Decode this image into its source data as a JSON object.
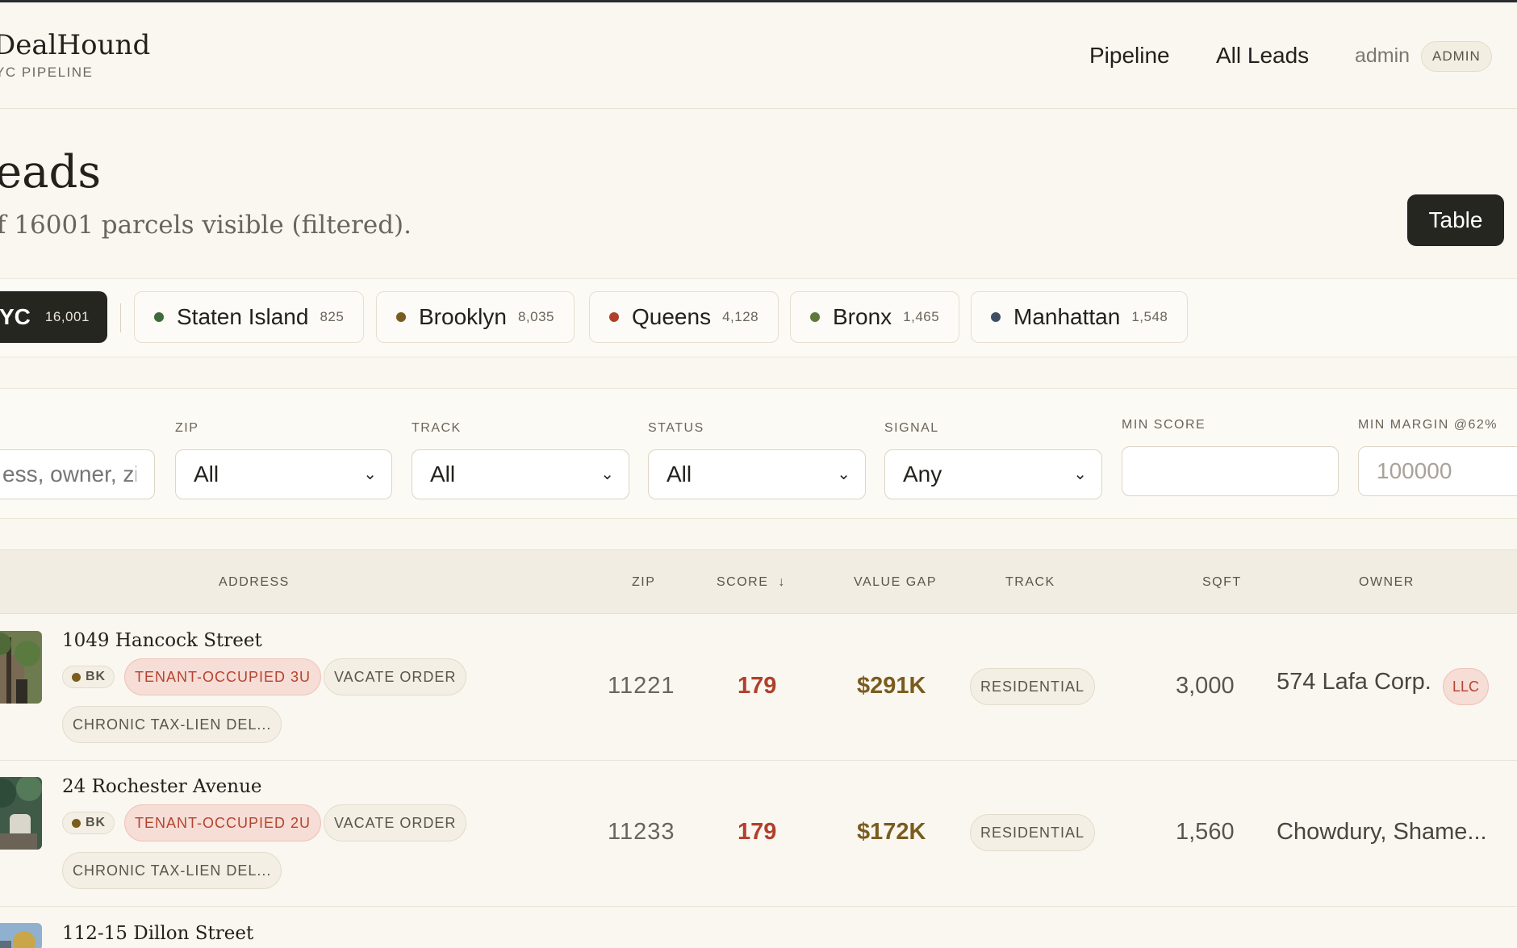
{
  "header": {
    "brand": "DealHound",
    "subtitle": "YC PIPELINE",
    "nav": [
      "Pipeline",
      "All Leads"
    ],
    "user": "admin",
    "role": "ADMIN"
  },
  "page": {
    "title": "eads",
    "summary": "f 16001 parcels visible (filtered).",
    "view_toggle": "Table"
  },
  "boroughs": [
    {
      "label": "YC",
      "count": "16,001",
      "selected": true
    },
    {
      "label": "Staten Island",
      "count": "825",
      "color": "#3f6b3a"
    },
    {
      "label": "Brooklyn",
      "count": "8,035",
      "color": "#7a5c1e"
    },
    {
      "label": "Queens",
      "count": "4,128",
      "color": "#b0402b"
    },
    {
      "label": "Bronx",
      "count": "1,465",
      "color": "#5e7a3a"
    },
    {
      "label": "Manhattan",
      "count": "1,548",
      "color": "#3f4f63"
    }
  ],
  "filters": {
    "search_placeholder": "ess, owner, zi",
    "zip": {
      "label": "ZIP",
      "value": "All"
    },
    "track": {
      "label": "TRACK",
      "value": "All"
    },
    "status": {
      "label": "STATUS",
      "value": "All"
    },
    "signal": {
      "label": "SIGNAL",
      "value": "Any"
    },
    "min_score": {
      "label": "MIN SCORE",
      "value": ""
    },
    "min_margin": {
      "label": "MIN MARGIN @62%",
      "placeholder": "100000"
    }
  },
  "table": {
    "columns": [
      "ADDRESS",
      "ZIP",
      "SCORE",
      "VALUE GAP",
      "TRACK",
      "SQFT",
      "OWNER"
    ],
    "sort_indicator": "↓",
    "rows": [
      {
        "address": "1049 Hancock Street",
        "borough": "BK",
        "tags": [
          "TENANT-OCCUPIED 3U",
          "VACATE ORDER",
          "CHRONIC TAX-LIEN DEL..."
        ],
        "zip": "11221",
        "score": "179",
        "value_gap": "$291K",
        "track": "RESIDENTIAL",
        "sqft": "3,000",
        "owner": "574 Lafa Corp.",
        "owner_type": "LLC"
      },
      {
        "address": "24 Rochester Avenue",
        "borough": "BK",
        "tags": [
          "TENANT-OCCUPIED 2U",
          "VACATE ORDER",
          "CHRONIC TAX-LIEN DEL..."
        ],
        "zip": "11233",
        "score": "179",
        "value_gap": "$172K",
        "track": "RESIDENTIAL",
        "sqft": "1,560",
        "owner": "Chowdury, Shame..."
      },
      {
        "address": "112-15 Dillon Street"
      }
    ]
  }
}
